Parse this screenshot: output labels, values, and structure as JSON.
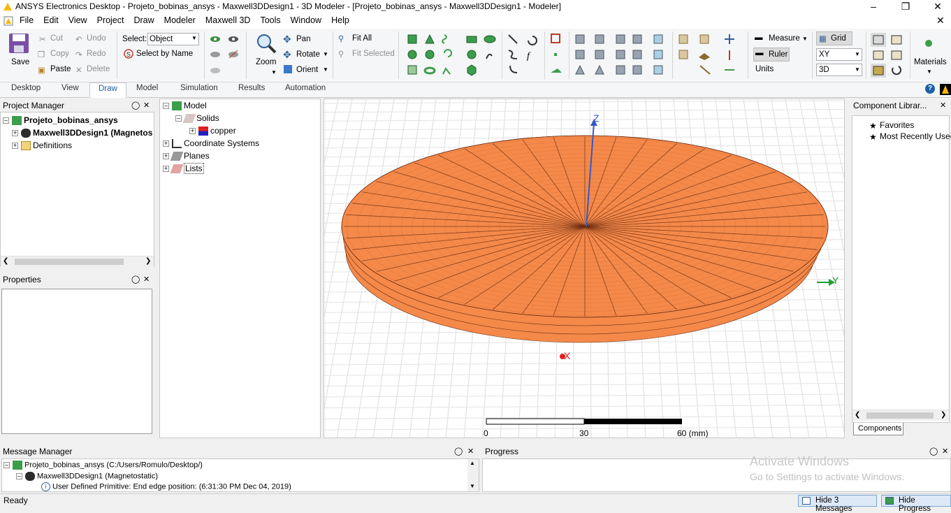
{
  "window": {
    "title": "ANSYS Electronics Desktop - Projeto_bobinas_ansys - Maxwell3DDesign1 - 3D Modeler - [Projeto_bobinas_ansys - Maxwell3DDesign1 - Modeler]"
  },
  "menu": [
    "File",
    "Edit",
    "View",
    "Project",
    "Draw",
    "Modeler",
    "Maxwell 3D",
    "Tools",
    "Window",
    "Help"
  ],
  "ribbon": {
    "save": "Save",
    "cut": "Cut",
    "copy": "Copy",
    "paste": "Paste",
    "undo": "Undo",
    "redo": "Redo",
    "delete": "Delete",
    "select_label": "Select:",
    "select_value": "Object",
    "select_by_name": "Select by Name",
    "zoom": "Zoom",
    "pan": "Pan",
    "rotate": "Rotate",
    "orient": "Orient",
    "fit_all": "Fit All",
    "fit_selected": "Fit Selected",
    "measure": "Measure",
    "ruler": "Ruler",
    "units": "Units",
    "grid": "Grid",
    "plane": "XY",
    "dim": "3D",
    "materials": "Materials"
  },
  "tabs": [
    "Desktop",
    "View",
    "Draw",
    "Model",
    "Simulation",
    "Results",
    "Automation"
  ],
  "active_tab": "Draw",
  "project_manager": {
    "title": "Project Manager",
    "project": "Projeto_bobinas_ansys",
    "design": "Maxwell3DDesign1 (Magnetos",
    "definitions": "Definitions"
  },
  "model_tree": {
    "model": "Model",
    "solids": "Solids",
    "copper": "copper",
    "coord": "Coordinate Systems",
    "planes": "Planes",
    "lists": "Lists"
  },
  "properties": {
    "title": "Properties"
  },
  "component_library": {
    "title": "Component Librar...",
    "favorites": "Favorites",
    "recent": "Most Recently Usec",
    "tab": "Components"
  },
  "viewport": {
    "axis_z": "Z",
    "axis_y": "Y",
    "axis_x": "X",
    "scale": [
      "0",
      "30",
      "60 (mm)"
    ],
    "disk_color": "#f4894a",
    "edge_color": "#6b2c10"
  },
  "message_manager": {
    "title": "Message Manager",
    "line1": "Projeto_bobinas_ansys (C:/Users/Romulo/Desktop/)",
    "line2": "Maxwell3DDesign1 (Magnetostatic)",
    "line3": "User Defined Primitive: End edge position: (6:31:30 PM  Dec 04, 2019)"
  },
  "progress": {
    "title": "Progress"
  },
  "watermark": {
    "line1": "Activate Windows",
    "line2": "Go to Settings to activate Windows."
  },
  "status": {
    "text": "Ready",
    "hide_messages": "Hide 3 Messages",
    "hide_progress": "Hide Progress"
  }
}
